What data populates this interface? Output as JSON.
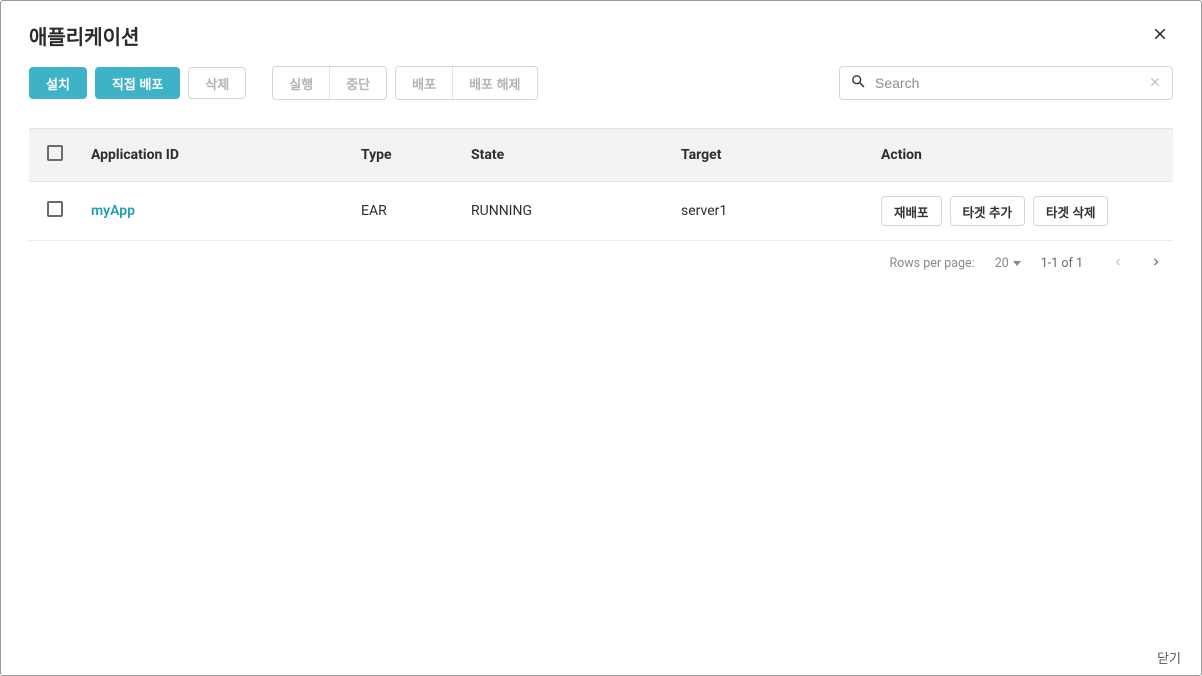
{
  "header": {
    "title": "애플리케이션"
  },
  "toolbar": {
    "install": "설치",
    "direct_deploy": "직접 배포",
    "delete": "삭제",
    "run": "실행",
    "stop": "중단",
    "deploy": "배포",
    "undeploy": "배포 해제"
  },
  "search": {
    "placeholder": "Search"
  },
  "table": {
    "columns": {
      "app_id": "Application ID",
      "type": "Type",
      "state": "State",
      "target": "Target",
      "action": "Action"
    },
    "rows": [
      {
        "app_id": "myApp",
        "type": "EAR",
        "state": "RUNNING",
        "target": "server1",
        "actions": {
          "redeploy": "재배포",
          "add_target": "타겟 추가",
          "remove_target": "타겟 삭제"
        }
      }
    ]
  },
  "pagination": {
    "rows_per_page_label": "Rows per page:",
    "rows_per_page_value": "20",
    "range": "1-1 of 1"
  },
  "footer": {
    "close": "닫기"
  }
}
